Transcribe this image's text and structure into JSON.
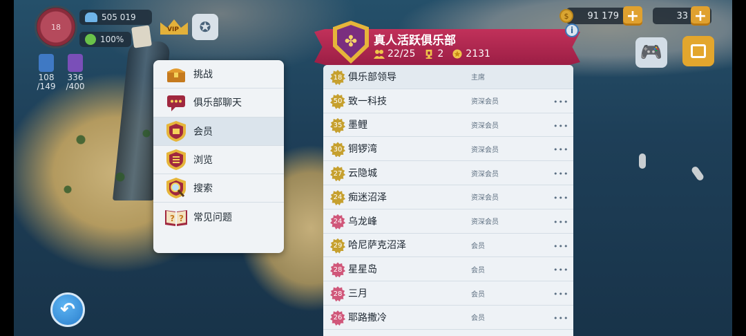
{
  "hud": {
    "level": "18",
    "population": "505 019",
    "happiness": "100%",
    "resource_1": {
      "current": "108",
      "max": "/149"
    },
    "resource_2": {
      "current": "336",
      "max": "/400"
    },
    "vip_label": "VIP",
    "simoleons": "91 179",
    "simcash": "33"
  },
  "menu": {
    "items": [
      {
        "label": "挑战",
        "icon": "treasure-chest-icon"
      },
      {
        "label": "俱乐部聊天",
        "icon": "chat-bubble-icon"
      },
      {
        "label": "会员",
        "icon": "members-shield-icon",
        "selected": true
      },
      {
        "label": "浏览",
        "icon": "browse-shield-icon"
      },
      {
        "label": "搜索",
        "icon": "search-magnifier-icon"
      },
      {
        "label": "常见问题",
        "icon": "faq-book-icon"
      }
    ]
  },
  "club": {
    "name": "真人活跃俱乐部",
    "members_count": "22/25",
    "trophies": "2",
    "points": "2131",
    "info_label": "i"
  },
  "members": [
    {
      "level": "18",
      "name": "俱乐部领导",
      "role": "主席",
      "badge": "gold",
      "leader": true
    },
    {
      "level": "50",
      "name": "致一科技",
      "role": "资深会员",
      "badge": "gold"
    },
    {
      "level": "35",
      "name": "墨鲤",
      "role": "资深会员",
      "badge": "gold"
    },
    {
      "level": "30",
      "name": "铜锣湾",
      "role": "资深会员",
      "badge": "gold"
    },
    {
      "level": "27",
      "name": "云隐城",
      "role": "资深会员",
      "badge": "gold"
    },
    {
      "level": "24",
      "name": "痴迷沼泽",
      "role": "资深会员",
      "badge": "gold"
    },
    {
      "level": "24",
      "name": "乌龙峰",
      "role": "资深会员",
      "badge": "pink"
    },
    {
      "level": "29",
      "name": "哈尼萨克沼泽",
      "role": "会员",
      "badge": "gold"
    },
    {
      "level": "28",
      "name": "星星岛",
      "role": "会员",
      "badge": "pink"
    },
    {
      "level": "28",
      "name": "三月",
      "role": "会员",
      "badge": "pink"
    },
    {
      "level": "26",
      "name": "耶路撒冷",
      "role": "会员",
      "badge": "pink"
    }
  ],
  "more_label": "•••",
  "colors": {
    "banner": "#b0264f",
    "menu_bg": "#f0f3f6",
    "accent_gold": "#e0a12f"
  }
}
